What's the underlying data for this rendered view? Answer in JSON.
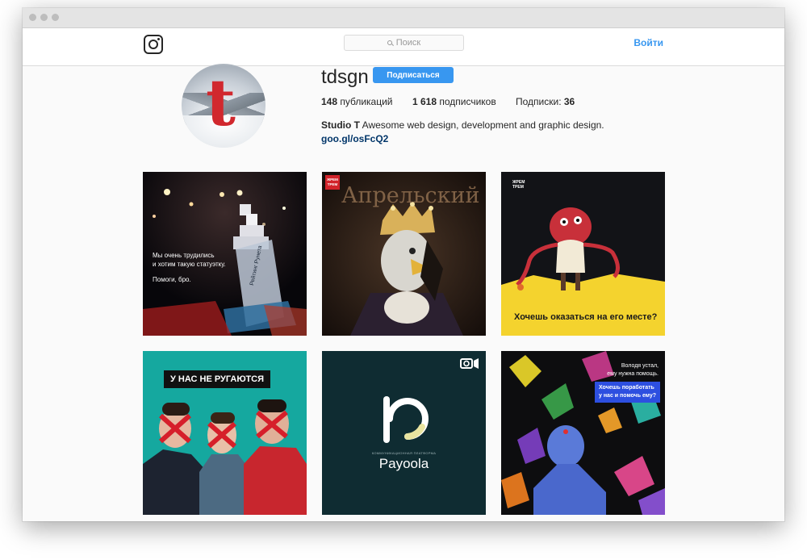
{
  "nav": {
    "search_placeholder": "Поиск",
    "login_label": "Войти"
  },
  "profile": {
    "username": "tdsgn",
    "follow_label": "Подписаться",
    "posts_count": "148",
    "posts_label": " публикаций",
    "followers_count": "1 618",
    "followers_label": " подписчиков",
    "following_label": "Подписки: ",
    "following_count": "36",
    "bio_name": "Studio T",
    "bio_text": " Awesome web design, development and graphic design.",
    "link": "goo.gl/osFcQ2"
  },
  "posts": [
    {
      "id": "award",
      "text1": "Мы очень трудились",
      "text2": "и хотим такую статуэтку.",
      "text3": "Помоги, бро.",
      "trophy_text": "Рейтинг Рунета"
    },
    {
      "id": "april",
      "title": "Апрельский",
      "badge": "ЖРЕМ ТРЕМ"
    },
    {
      "id": "monster",
      "badge": "ЖРЕМ ТРЕМ",
      "caption": "Хочешь оказаться на его месте?"
    },
    {
      "id": "swear",
      "banner": "У НАС НЕ РУГАЮТСЯ"
    },
    {
      "id": "payoola",
      "brand": "Payoola",
      "subtitle": "КОММУНИКАЦИОННАЯ ПЛАТФОРМА"
    },
    {
      "id": "leaves",
      "text1": "Володя устал,",
      "text2": "ему нужна помощь.",
      "text3": "Хочешь поработать",
      "text4": "у нас и помочь ему?"
    }
  ],
  "colors": {
    "accent": "#3897f0",
    "link": "#003569",
    "yellow": "#f4d32e",
    "dark_teal": "#0f2c32",
    "teal": "#13b0a7"
  }
}
